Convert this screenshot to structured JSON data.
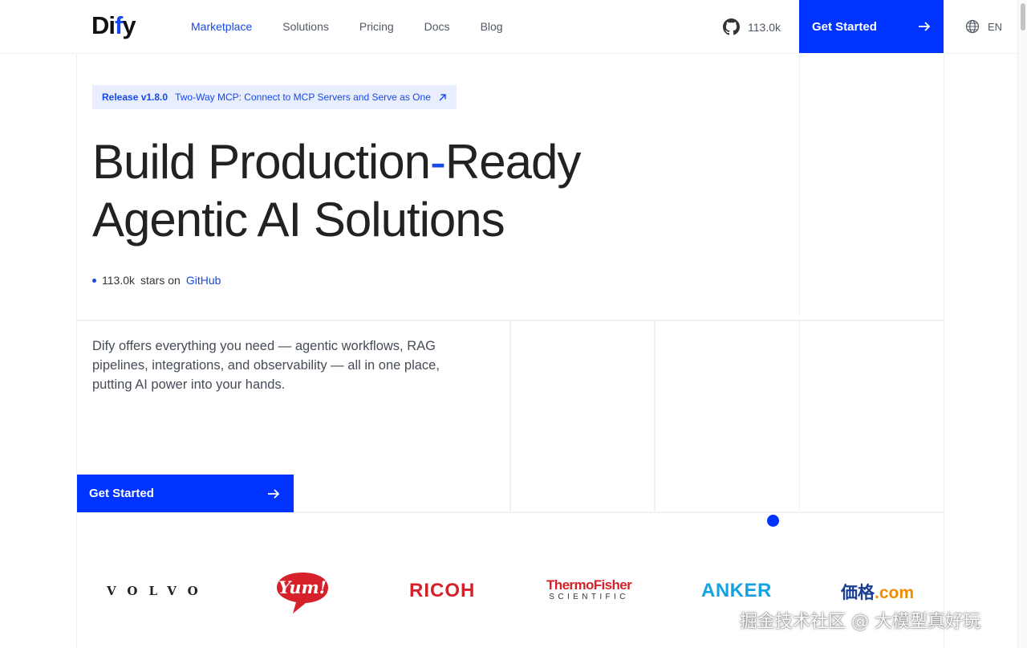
{
  "header": {
    "logo": {
      "left": "Di",
      "mid": "f",
      "right": "y"
    },
    "nav": [
      {
        "label": "Marketplace",
        "active": true
      },
      {
        "label": "Solutions",
        "active": false
      },
      {
        "label": "Pricing",
        "active": false
      },
      {
        "label": "Docs",
        "active": false
      },
      {
        "label": "Blog",
        "active": false
      }
    ],
    "github_stars": "113.0k",
    "cta_label": "Get Started",
    "language": "EN"
  },
  "hero": {
    "release_version": "Release v1.8.0",
    "release_text": "Two-Way MCP: Connect to MCP Servers and Serve as One",
    "title_part1": "Build Production",
    "title_dash": "-",
    "title_part2": "Ready",
    "title_line2": "Agentic AI Solutions",
    "stars_count": "113.0k",
    "stars_text": "stars on",
    "stars_link": "GitHub",
    "description": "Dify offers everything you need — agentic workflows, RAG pipelines, integrations, and observability — all in one place, putting AI power into your hands.",
    "cta_label": "Get Started"
  },
  "customer_logos": {
    "volvo": "VOLVO",
    "yum": "Yum!",
    "ricoh": "RICOH",
    "thermo_line1": "ThermoFisher",
    "thermo_line2": "SCIENTIFIC",
    "anker": "ANKER",
    "kakaku_main": "価格",
    "kakaku_suffix": ".com"
  },
  "watermark": "掘金技术社区 @ 大模型真好玩",
  "colors": {
    "accent": "#0033ff",
    "link": "#1749e8",
    "badge_bg": "#e8eefe",
    "grid_line": "#eef1f5"
  }
}
